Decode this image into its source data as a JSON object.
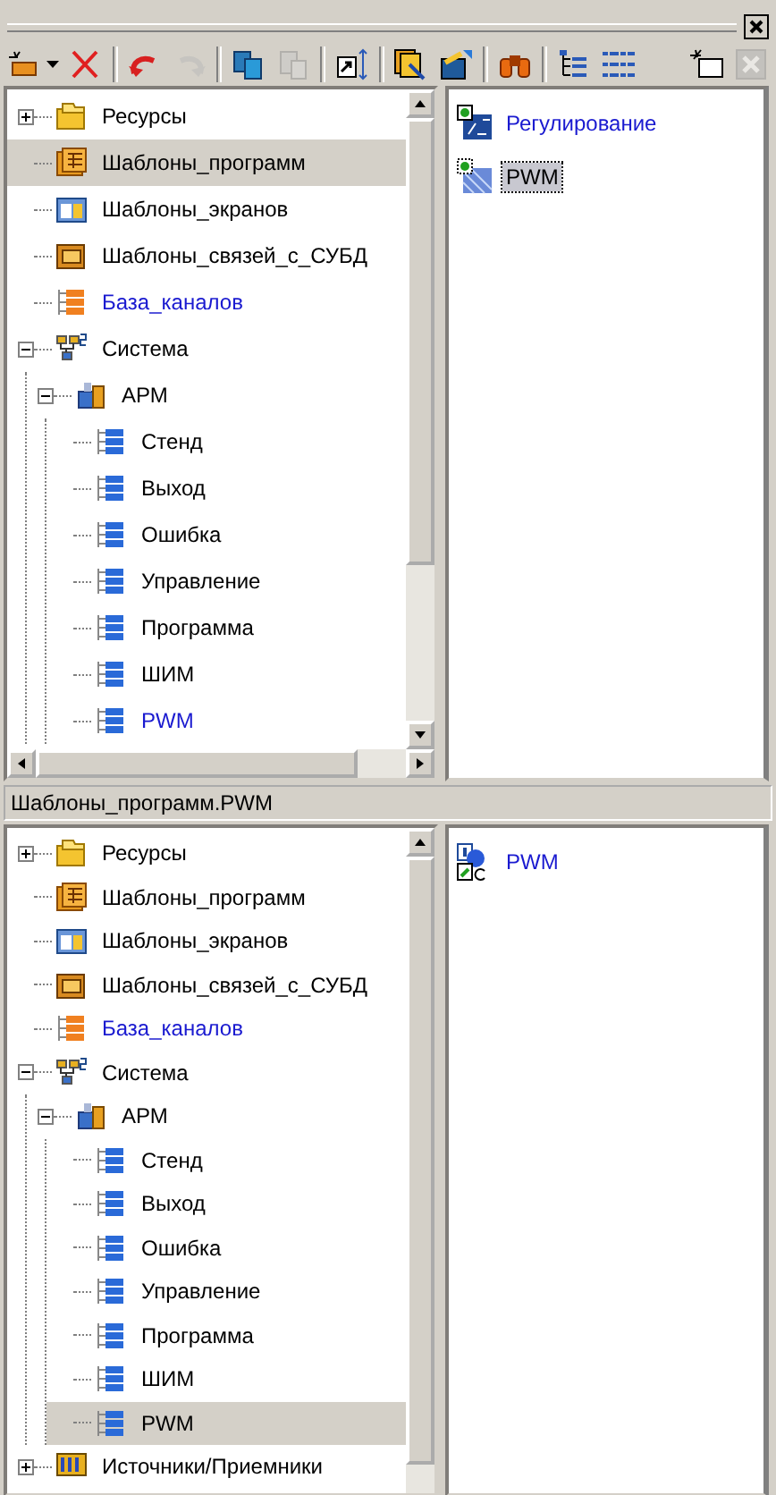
{
  "toolbar": [
    {
      "kind": "new",
      "disabled": false
    },
    {
      "kind": "delete",
      "disabled": false
    },
    {
      "kind": "separator"
    },
    {
      "kind": "undo",
      "disabled": false
    },
    {
      "kind": "redo",
      "disabled": true
    },
    {
      "kind": "separator"
    },
    {
      "kind": "copy",
      "disabled": false
    },
    {
      "kind": "paste",
      "disabled": true
    },
    {
      "kind": "separator"
    },
    {
      "kind": "resize",
      "disabled": false
    },
    {
      "kind": "separator"
    },
    {
      "kind": "templates",
      "disabled": false
    },
    {
      "kind": "export",
      "disabled": false
    },
    {
      "kind": "separator"
    },
    {
      "kind": "find",
      "disabled": false
    },
    {
      "kind": "separator"
    },
    {
      "kind": "tree",
      "disabled": false
    },
    {
      "kind": "list",
      "disabled": false
    },
    {
      "kind": "spacer"
    },
    {
      "kind": "new-window",
      "disabled": false
    },
    {
      "kind": "close",
      "disabled": true
    }
  ],
  "top_tree": [
    {
      "label": "Ресурсы",
      "kind": "folder",
      "expanded": false,
      "selected": false,
      "active": false
    },
    {
      "label": "Шаблоны_программ",
      "kind": "program-templates",
      "selected": true,
      "active": false
    },
    {
      "label": "Шаблоны_экранов",
      "kind": "screen-templates",
      "selected": false,
      "active": false
    },
    {
      "label": "Шаблоны_связей_с_СУБД",
      "kind": "db-templates",
      "selected": false,
      "active": false
    },
    {
      "label": "База_каналов",
      "kind": "channels",
      "selected": false,
      "active": true
    },
    {
      "label": "Система",
      "kind": "system",
      "expanded": true,
      "selected": false,
      "active": false,
      "children": [
        {
          "label": "АРМ",
          "kind": "workstation",
          "expanded": true,
          "selected": false,
          "active": false,
          "children": [
            {
              "label": "Стенд",
              "kind": "channel",
              "selected": false,
              "active": false
            },
            {
              "label": "Выход",
              "kind": "channel",
              "selected": false,
              "active": false
            },
            {
              "label": "Ошибка",
              "kind": "channel",
              "selected": false,
              "active": false
            },
            {
              "label": "Управление",
              "kind": "channel",
              "selected": false,
              "active": false
            },
            {
              "label": "Программа",
              "kind": "channel",
              "selected": false,
              "active": false
            },
            {
              "label": "ШИМ",
              "kind": "channel",
              "selected": false,
              "active": false
            },
            {
              "label": "PWM",
              "kind": "channel",
              "selected": false,
              "active": true
            }
          ]
        }
      ]
    }
  ],
  "top_list": [
    {
      "label": "Регулирование",
      "kind": "function",
      "selected": false,
      "active": true
    },
    {
      "label": "PWM",
      "kind": "function-pattern",
      "selected": true,
      "active": false
    }
  ],
  "status_bar": "Шаблоны_программ.PWM",
  "bottom_tree": [
    {
      "label": "Ресурсы",
      "kind": "folder",
      "expanded": false,
      "selected": false,
      "active": false
    },
    {
      "label": "Шаблоны_программ",
      "kind": "program-templates",
      "selected": false,
      "active": false
    },
    {
      "label": "Шаблоны_экранов",
      "kind": "screen-templates",
      "selected": false,
      "active": false
    },
    {
      "label": "Шаблоны_связей_с_СУБД",
      "kind": "db-templates",
      "selected": false,
      "active": false
    },
    {
      "label": "База_каналов",
      "kind": "channels",
      "selected": false,
      "active": true
    },
    {
      "label": "Система",
      "kind": "system",
      "expanded": true,
      "selected": false,
      "active": false,
      "children": [
        {
          "label": "АРМ",
          "kind": "workstation",
          "expanded": true,
          "selected": false,
          "active": false,
          "children": [
            {
              "label": "Стенд",
              "kind": "channel",
              "selected": false,
              "active": false
            },
            {
              "label": "Выход",
              "kind": "channel",
              "selected": false,
              "active": false
            },
            {
              "label": "Ошибка",
              "kind": "channel",
              "selected": false,
              "active": false
            },
            {
              "label": "Управление",
              "kind": "channel",
              "selected": false,
              "active": false
            },
            {
              "label": "Программа",
              "kind": "channel",
              "selected": false,
              "active": false
            },
            {
              "label": "ШИМ",
              "kind": "channel",
              "selected": false,
              "active": false
            },
            {
              "label": "PWM",
              "kind": "channel",
              "selected": true,
              "active": false
            }
          ]
        }
      ]
    },
    {
      "label": "Источники/Приемники",
      "kind": "sources",
      "expanded": false,
      "selected": false,
      "active": false
    }
  ],
  "bottom_list": [
    {
      "label": "PWM",
      "kind": "class",
      "selected": false,
      "active": true
    }
  ]
}
